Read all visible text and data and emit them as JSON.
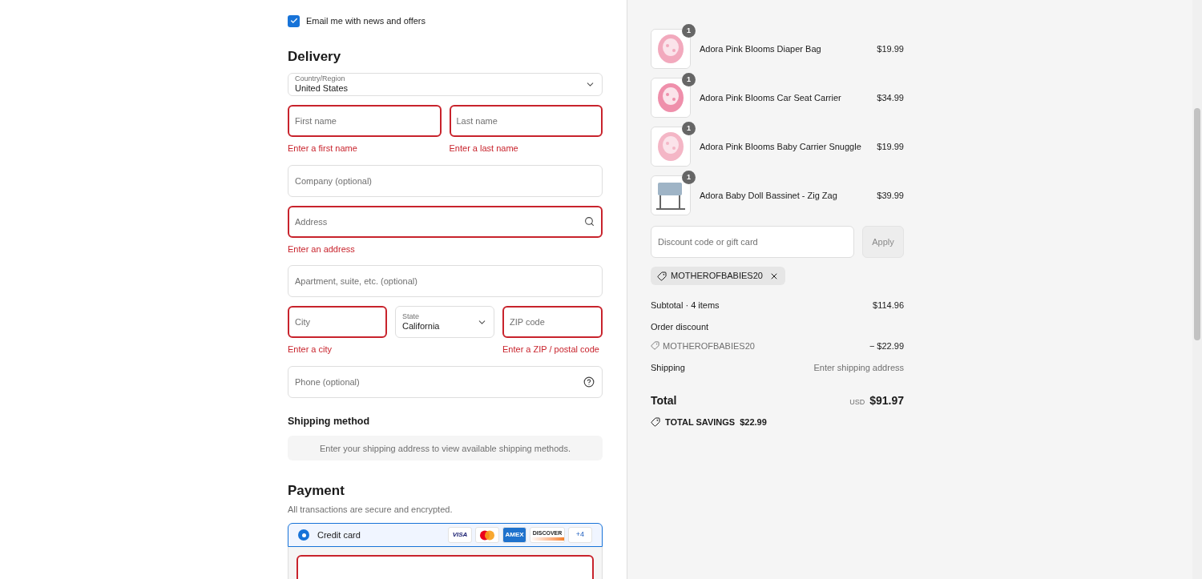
{
  "marketing": {
    "label": "Email me with news and offers",
    "checked": true
  },
  "delivery": {
    "title": "Delivery",
    "country": {
      "label": "Country/Region",
      "value": "United States"
    },
    "first_name": {
      "placeholder": "First name",
      "error": "Enter a first name"
    },
    "last_name": {
      "placeholder": "Last name",
      "error": "Enter a last name"
    },
    "company": {
      "placeholder": "Company (optional)"
    },
    "address": {
      "placeholder": "Address",
      "error": "Enter an address"
    },
    "apartment": {
      "placeholder": "Apartment, suite, etc. (optional)"
    },
    "city": {
      "placeholder": "City",
      "error": "Enter a city"
    },
    "state": {
      "label": "State",
      "value": "California"
    },
    "zip": {
      "placeholder": "ZIP code",
      "error": "Enter a ZIP / postal code"
    },
    "phone": {
      "placeholder": "Phone (optional)"
    }
  },
  "shipping_method": {
    "title": "Shipping method",
    "message": "Enter your shipping address to view available shipping methods."
  },
  "payment": {
    "title": "Payment",
    "subtitle": "All transactions are secure and encrypted.",
    "option": {
      "label": "Credit card",
      "selected": true
    },
    "cards": [
      {
        "kind": "visa",
        "text": "VISA"
      },
      {
        "kind": "mastercard"
      },
      {
        "kind": "amex",
        "text": "AMEX"
      },
      {
        "kind": "discover",
        "text": "DISCOVER"
      },
      {
        "kind": "more",
        "text": "+4"
      }
    ]
  },
  "summary": {
    "items": [
      {
        "name": "Adora Pink Blooms Diaper Bag",
        "price": "$19.99",
        "quantity": "1"
      },
      {
        "name": "Adora Pink Blooms Car Seat Carrier",
        "price": "$34.99",
        "quantity": "1"
      },
      {
        "name": "Adora Pink Blooms Baby Carrier Snuggle",
        "price": "$19.99",
        "quantity": "1"
      },
      {
        "name": "Adora Baby Doll Bassinet - Zig Zag",
        "price": "$39.99",
        "quantity": "1"
      }
    ],
    "discount": {
      "placeholder": "Discount code or gift card",
      "button": "Apply"
    },
    "applied_code": "MOTHEROFBABIES20",
    "subtotal": {
      "label": "Subtotal · 4 items",
      "value": "$114.96"
    },
    "order_discount": {
      "label": "Order discount",
      "code": "MOTHEROFBABIES20",
      "value": "− $22.99"
    },
    "shipping": {
      "label": "Shipping",
      "value": "Enter shipping address"
    },
    "total": {
      "label": "Total",
      "currency": "USD",
      "value": "$91.97"
    },
    "savings": {
      "label": "TOTAL SAVINGS",
      "value": "$22.99"
    }
  }
}
